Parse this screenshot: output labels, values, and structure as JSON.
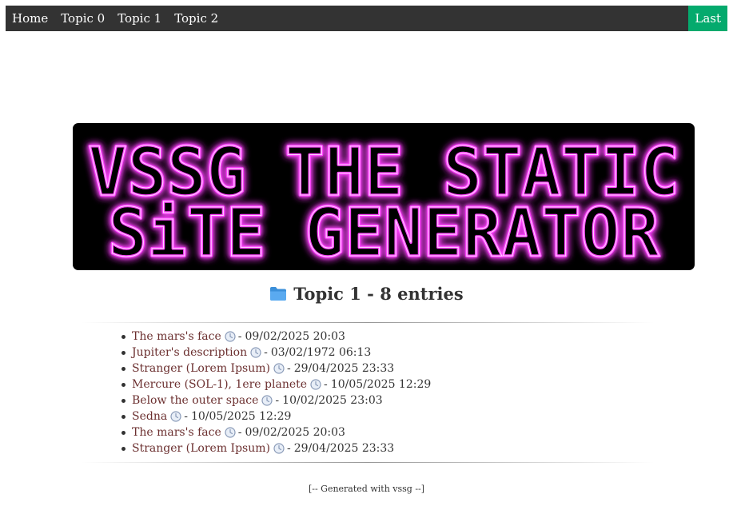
{
  "nav": {
    "items": [
      {
        "label": "Home"
      },
      {
        "label": "Topic 0"
      },
      {
        "label": "Topic 1"
      },
      {
        "label": "Topic 2"
      }
    ],
    "last_label": "Last",
    "last_color": "#04AA6D",
    "bar_color": "#333333"
  },
  "banner": {
    "line1": "VSSG THE STATIC",
    "line2": "SiTE GENERATOR",
    "glow_color": "#ff33ff"
  },
  "topic": {
    "icon": "folder-icon",
    "title": "Topic 1 - 8 entries"
  },
  "entries": [
    {
      "title": "The mars's face",
      "date": "09/02/2025 20:03"
    },
    {
      "title": "Jupiter's description",
      "date": "03/02/1972 06:13"
    },
    {
      "title": "Stranger (Lorem Ipsum)",
      "date": "29/04/2025 23:33"
    },
    {
      "title": "Mercure (SOL-1), 1ere planete",
      "date": "10/05/2025 12:29"
    },
    {
      "title": "Below the outer space",
      "date": "10/02/2025 23:03"
    },
    {
      "title": "Sedna",
      "date": "10/05/2025 12:29"
    },
    {
      "title": "The mars's face",
      "date": "09/02/2025 20:03"
    },
    {
      "title": "Stranger (Lorem Ipsum)",
      "date": "29/04/2025 23:33"
    }
  ],
  "entry_separator": "-",
  "footer": "[-- Generated with vssg --]"
}
